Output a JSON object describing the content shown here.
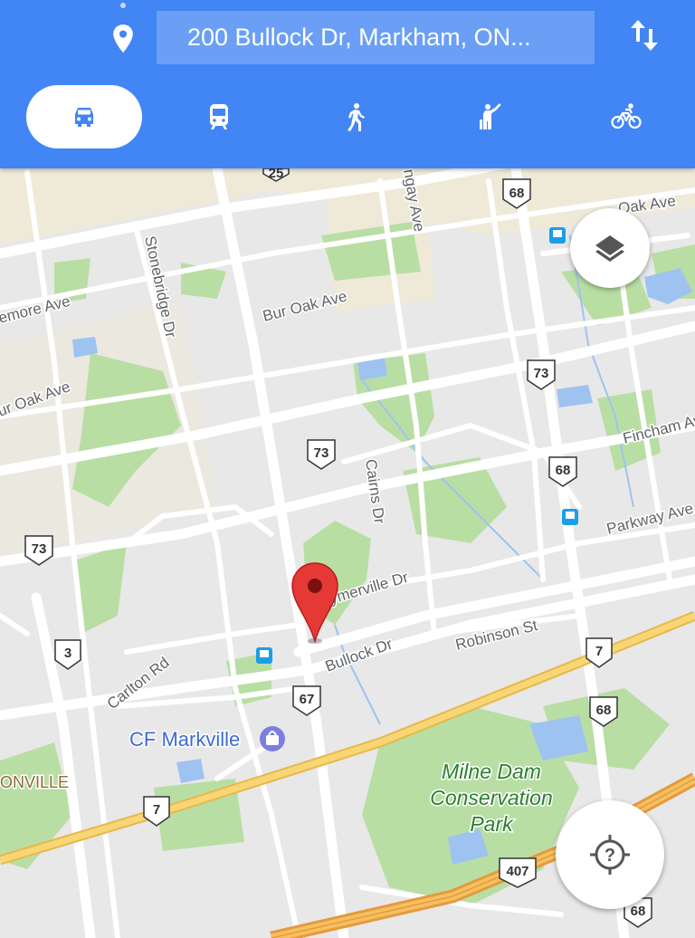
{
  "search": {
    "value": "200 Bullock Dr, Markham, ON..."
  },
  "modes": [
    {
      "icon": "car-icon",
      "selected": true
    },
    {
      "icon": "transit-icon",
      "selected": false
    },
    {
      "icon": "walk-icon",
      "selected": false
    },
    {
      "icon": "rideshare-icon",
      "selected": false
    },
    {
      "icon": "bike-icon",
      "selected": false
    }
  ],
  "colors": {
    "brand": "#4285f4",
    "marker": "#e53935",
    "park": "#a5d88f",
    "highway": "#f6c95c"
  },
  "map": {
    "roads": {
      "oak_ave": "Oak Ave",
      "bur_oak_ave_1": "Bur Oak Ave",
      "bur_oak_ave_2": "ur Oak Ave",
      "stonebridge_dr": "Stonebridge Dr",
      "whitmore_ave": "emore Ave",
      "angay_ave": "ngay Ave",
      "cairns_dr": "Cairns Dr",
      "fincham_ave": "Fincham Ave",
      "parkway_ave": "Parkway Ave",
      "raymerville_dr": "ymerville Dr",
      "bullock_dr": "Bullock Dr",
      "robinson_st": "Robinson St",
      "carlton_rd": "Carlton Rd"
    },
    "shields": {
      "r25": "25",
      "r68a": "68",
      "r68b": "68",
      "r68c": "68",
      "r68d": "68",
      "r73a": "73",
      "r73b": "73",
      "r73c": "73",
      "r7a": "7",
      "r7b": "7",
      "r3": "3",
      "r67": "67",
      "r407": "407"
    },
    "poi": {
      "cf_markville": "CF Markville",
      "unionville": "ONVILLE"
    },
    "park": {
      "line1": "Milne Dam",
      "line2": "Conservation",
      "line3": "Park"
    }
  },
  "controls": {
    "layers_icon": "layers-icon",
    "locate_icon": "locate-question-icon"
  }
}
